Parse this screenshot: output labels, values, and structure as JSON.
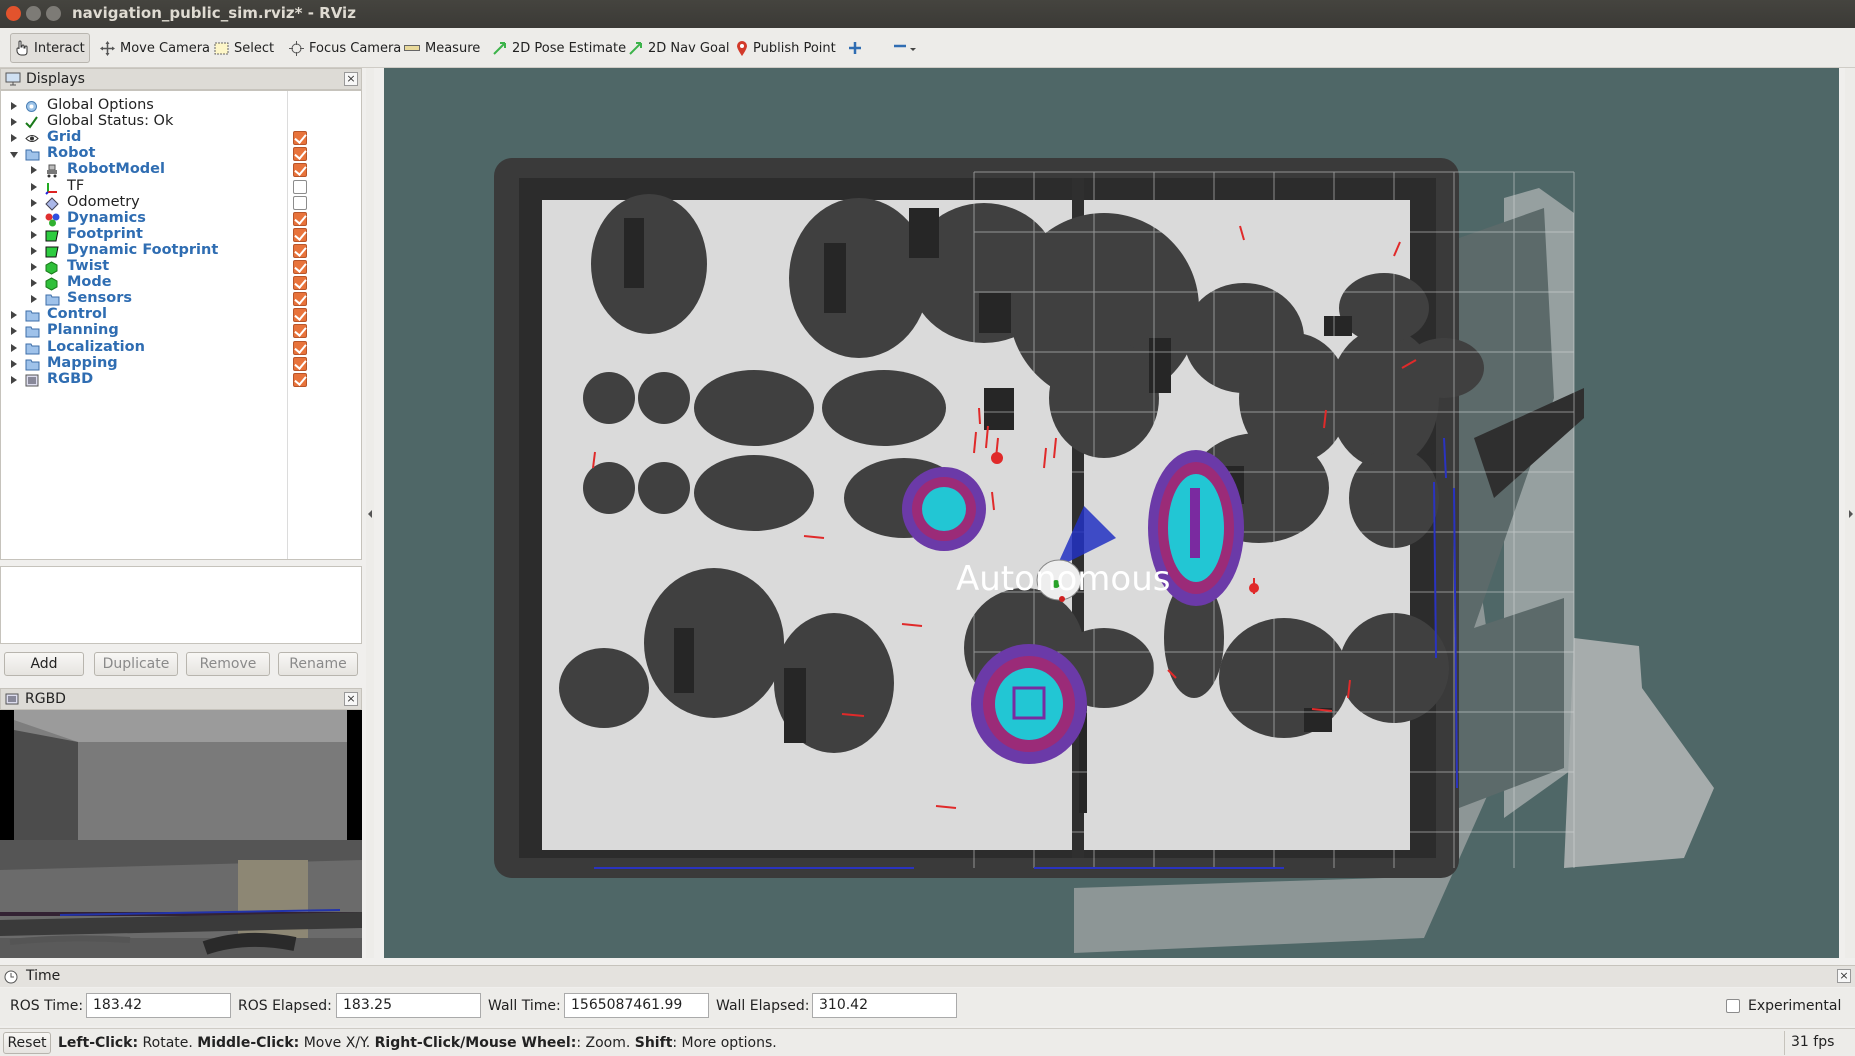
{
  "window": {
    "title": "navigation_public_sim.rviz* - RViz"
  },
  "toolbar": {
    "interact": "Interact",
    "move_camera": "Move Camera",
    "select": "Select",
    "focus_camera": "Focus Camera",
    "measure": "Measure",
    "pose_estimate": "2D Pose Estimate",
    "nav_goal": "2D Nav Goal",
    "publish_point": "Publish Point"
  },
  "displays": {
    "title": "Displays",
    "items": [
      {
        "label": "Global Options",
        "level": 0,
        "expanded": false,
        "style": "plain",
        "icon": "gear-icon",
        "checked": null
      },
      {
        "label": "Global Status: Ok",
        "level": 0,
        "expanded": false,
        "style": "plain",
        "icon": "check-icon",
        "checked": null
      },
      {
        "label": "Grid",
        "level": 0,
        "expanded": false,
        "style": "blue",
        "icon": "grid-icon",
        "checked": true
      },
      {
        "label": "Robot",
        "level": 0,
        "expanded": true,
        "style": "blue",
        "icon": "folder-icon",
        "checked": true
      },
      {
        "label": "RobotModel",
        "level": 1,
        "expanded": false,
        "style": "blue",
        "icon": "robot-model-icon",
        "checked": true
      },
      {
        "label": "TF",
        "level": 1,
        "expanded": false,
        "style": "plain",
        "icon": "tf-axes-icon",
        "checked": false
      },
      {
        "label": "Odometry",
        "level": 1,
        "expanded": false,
        "style": "plain",
        "icon": "odometry-icon",
        "checked": false
      },
      {
        "label": "Dynamics",
        "level": 1,
        "expanded": false,
        "style": "blue",
        "icon": "marker-icon",
        "checked": true
      },
      {
        "label": "Footprint",
        "level": 1,
        "expanded": false,
        "style": "blue",
        "icon": "polygon-icon",
        "checked": true
      },
      {
        "label": "Dynamic Footprint",
        "level": 1,
        "expanded": false,
        "style": "blue",
        "icon": "polygon-icon",
        "checked": true
      },
      {
        "label": "Twist",
        "level": 1,
        "expanded": false,
        "style": "blue",
        "icon": "cube-icon",
        "checked": true
      },
      {
        "label": "Mode",
        "level": 1,
        "expanded": false,
        "style": "blue",
        "icon": "cube-icon",
        "checked": true
      },
      {
        "label": "Sensors",
        "level": 1,
        "expanded": false,
        "style": "blue",
        "icon": "folder-icon",
        "checked": true
      },
      {
        "label": "Control",
        "level": 0,
        "expanded": false,
        "style": "blue",
        "icon": "folder-icon",
        "checked": true
      },
      {
        "label": "Planning",
        "level": 0,
        "expanded": false,
        "style": "blue",
        "icon": "folder-icon",
        "checked": true
      },
      {
        "label": "Localization",
        "level": 0,
        "expanded": false,
        "style": "blue",
        "icon": "folder-icon",
        "checked": true
      },
      {
        "label": "Mapping",
        "level": 0,
        "expanded": false,
        "style": "blue",
        "icon": "folder-icon",
        "checked": true
      },
      {
        "label": "RGBD",
        "level": 0,
        "expanded": false,
        "style": "blue",
        "icon": "camera-display-icon",
        "checked": true
      }
    ],
    "buttons": {
      "add": "Add",
      "duplicate": "Duplicate",
      "remove": "Remove",
      "rename": "Rename"
    }
  },
  "camera_panel": {
    "title": "RGBD"
  },
  "viewport": {
    "overlay_text": "Autonomous"
  },
  "time": {
    "title": "Time",
    "ros_time_label": "ROS Time:",
    "ros_time": "183.42",
    "ros_elapsed_label": "ROS Elapsed:",
    "ros_elapsed": "183.25",
    "wall_time_label": "Wall Time:",
    "wall_time": "1565087461.99",
    "wall_elapsed_label": "Wall Elapsed:",
    "wall_elapsed": "310.42",
    "experimental_label": "Experimental",
    "experimental": false
  },
  "status": {
    "reset": "Reset",
    "left_click": "Left-Click:",
    "left_click_action": " Rotate. ",
    "middle_click": "Middle-Click:",
    "middle_click_action": " Move X/Y. ",
    "right_click": "Right-Click/Mouse Wheel:",
    "right_click_action": ": Zoom. ",
    "shift": "Shift",
    "shift_action": ": More options.",
    "fps": "31 fps"
  },
  "colors": {
    "accent_check": "#e8733b",
    "tree_blue": "#2f6db2",
    "viewport_bg": "#4f6767"
  }
}
